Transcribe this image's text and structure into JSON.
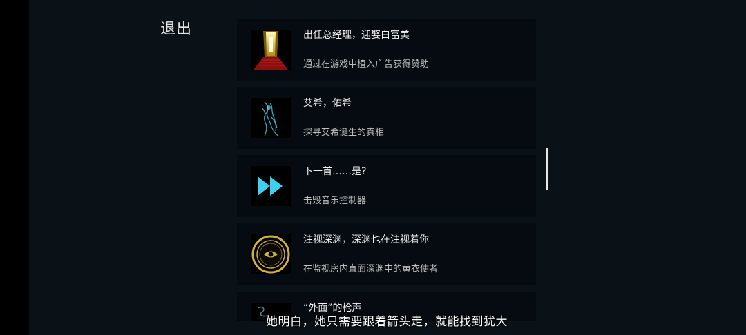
{
  "exit_label": "退出",
  "achievements": [
    {
      "title": "出任总经理，迎娶白富美",
      "desc": "通过在游戏中植入广告获得赞助",
      "icon": "golden-door-icon"
    },
    {
      "title": "艾希，佑希",
      "desc": "探寻艾希诞生的真相",
      "icon": "blue-spectral-figure-icon"
    },
    {
      "title": "下一首……是?",
      "desc": "击毁音乐控制器",
      "icon": "fast-forward-icon"
    },
    {
      "title": "注视深渊，深渊也在注视着你",
      "desc": "在监视房内直面深渊中的黄衣使者",
      "icon": "eye-sigil-icon"
    },
    {
      "title": "“外面”的枪声",
      "desc": "",
      "icon": "smoke-wisp-icon"
    }
  ],
  "subtitle": "她明白，她只需要跟着箭头走，就能找到犹大",
  "colors": {
    "background": "#0a1218",
    "card": "#050b10",
    "accent_cyan": "#3fd0f0",
    "accent_gold": "#d4b23a"
  }
}
